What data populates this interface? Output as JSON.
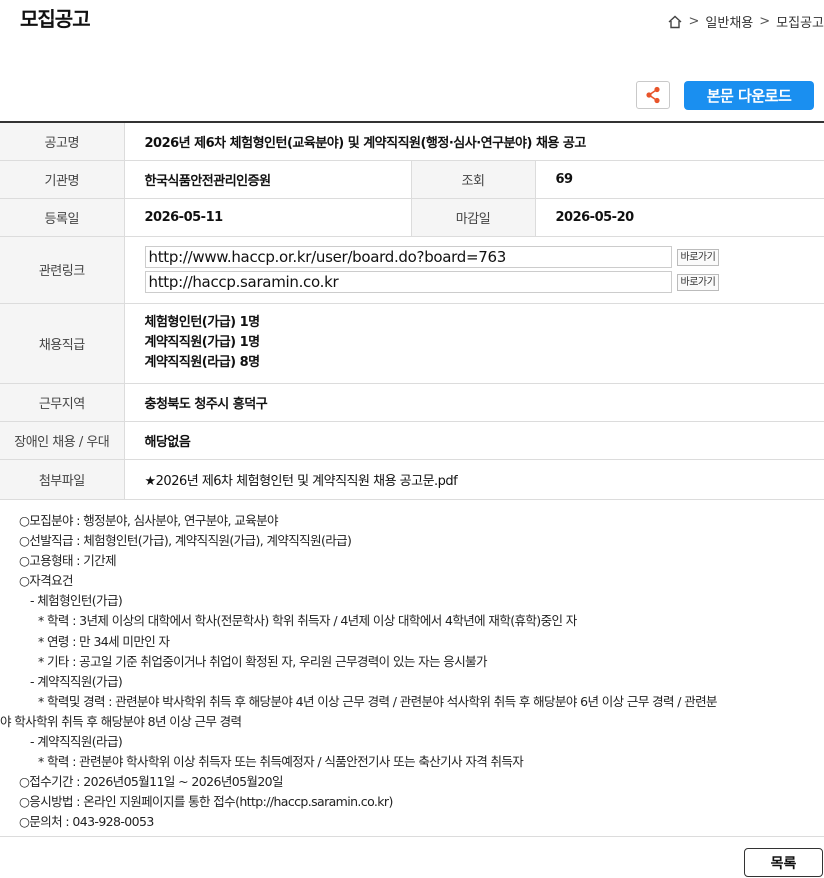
{
  "page": {
    "title": "모집공고",
    "breadcrumb": [
      "일반채용",
      "모집공고"
    ],
    "breadcrumb_sep": ">"
  },
  "actions": {
    "download_label": "본문 다운로드",
    "list_label": "목록",
    "go_label": "바로가기"
  },
  "info": {
    "title_label": "공고명",
    "title_value": "2026년 제6차 체험형인턴(교육분야) 및 계약직직원(행정·심사·연구분야) 채용 공고",
    "org_label": "기관명",
    "org_value": "한국식품안전관리인증원",
    "views_label": "조회",
    "views_value": "69",
    "reg_label": "등록일",
    "reg_value": "2026-05-11",
    "deadline_label": "마감일",
    "deadline_value": "2026-05-20",
    "links_label": "관련링크",
    "links": [
      "http://www.haccp.or.kr/user/board.do?board=763",
      "http://haccp.saramin.co.kr"
    ],
    "positions_label": "채용직급",
    "positions": [
      "체험형인턴(가급) 1명",
      "계약직직원(가급) 1명",
      "계약직직원(라급) 8명"
    ],
    "location_label": "근무지역",
    "location_value": "충청북도 청주시 흥덕구",
    "disability_label": "장애인 채용 / 우대",
    "disability_value": "해당없음",
    "attach_label": "첨부파일",
    "attach_value": "★2026년 제6차 체험형인턴 및 계약직직원 채용 공고문.pdf"
  },
  "body": {
    "l1": "○모집분야 : 행정분야, 심사분야, 연구분야, 교육분야",
    "l2": "○선발직급 : 체험형인턴(가급), 계약직직원(가급), 계약직직원(라급)",
    "l3": "○고용형태 : 기간제",
    "l4": "○자격요건",
    "l5": "- 체험형인턴(가급)",
    "l6": "* 학력 : 3년제 이상의 대학에서 학사(전문학사) 학위 취득자 / 4년제 이상 대학에서 4학년에 재학(휴학)중인 자",
    "l7": "* 연령 : 만 34세 미만인 자",
    "l8": "* 기타 : 공고일 기준 취업중이거나 취업이 확정된 자, 우리원 근무경력이 있는 자는 응시불가",
    "l9": "- 계약직직원(가급)",
    "l10": "* 학력및 경력 : 관련분야 박사학위 취득 후 해당분야 4년 이상 근무 경력 / 관련분야 석사학위 취득 후 해당분야 6년 이상 근무 경력 / 관련분",
    "l11": "야 학사학위 취득 후 해당분야 8년 이상 근무 경력",
    "l12": "- 계약직직원(라급)",
    "l13": "* 학력 : 관련분야 학사학위 이상 취득자 또는 취득예정자 / 식품안전기사 또는 축산기사 자격 취득자",
    "l14": "○접수기간 : 2026년05월11일 ~ 2026년05월20일",
    "l15": "○응시방법 : 온라인 지원페이지를 통한 접수(http://haccp.saramin.co.kr)",
    "l16": "○문의처 : 043-928-0053"
  },
  "icons": {
    "home": "home-icon",
    "share": "share-icon"
  },
  "colors": {
    "accent": "#1a8ff0",
    "share": "#e8542a",
    "header_bg": "#f5f5f5"
  }
}
